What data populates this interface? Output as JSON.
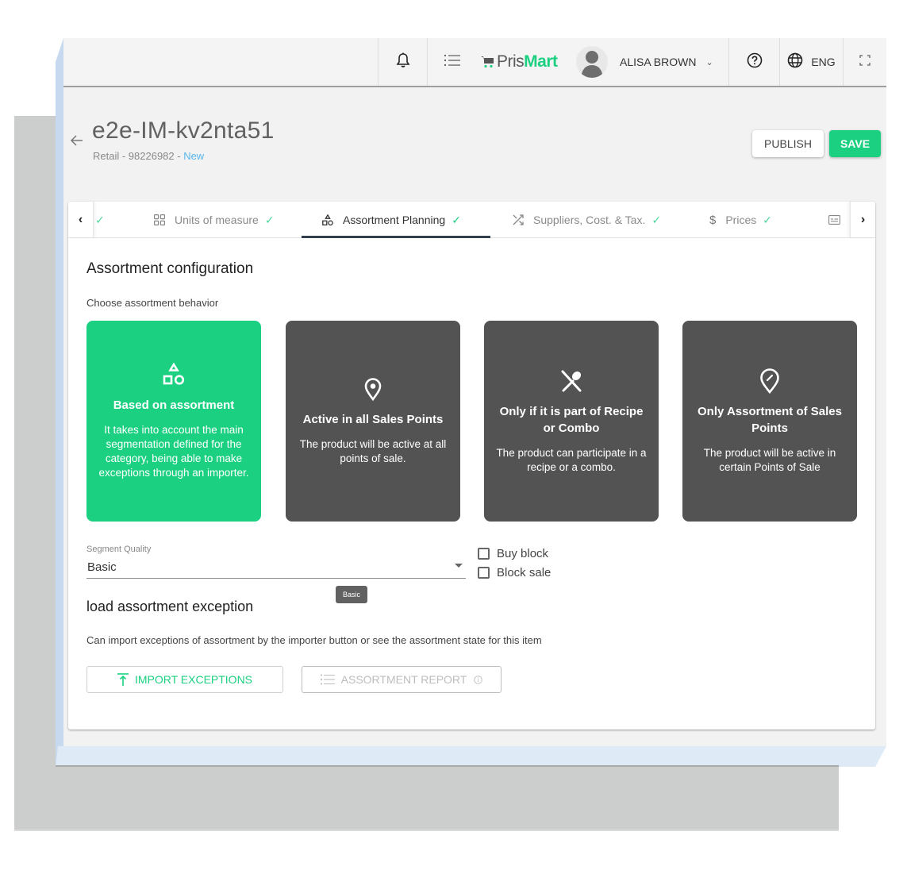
{
  "topbar": {
    "brand_prefix": "Pris",
    "brand_suffix": "Mart",
    "user_name": "ALISA BROWN",
    "language": "ENG",
    "icons": [
      "bell-icon",
      "list-menu-icon",
      "cart-icon",
      "avatar",
      "chevron-down-icon",
      "help-icon",
      "globe-icon",
      "fullscreen-icon"
    ]
  },
  "header": {
    "title": "e2e-IM-kv2nta51",
    "subtitle_prefix": "Retail - 98226982 - ",
    "status": "New",
    "publish_label": "PUBLISH",
    "save_label": "SAVE"
  },
  "tabs": [
    {
      "label": "",
      "icon": "check-icon",
      "completed": true
    },
    {
      "label": "Units of measure",
      "icon": "grid-icon",
      "completed": true
    },
    {
      "label": "Assortment Planning",
      "icon": "shapes-icon",
      "completed": true,
      "active": true
    },
    {
      "label": "Suppliers, Cost. & Tax.",
      "icon": "shuffle-icon",
      "completed": true
    },
    {
      "label": "Prices",
      "icon": "dollar-icon",
      "completed": true
    },
    {
      "label": "",
      "icon": "card-icon",
      "completed": false
    }
  ],
  "tab_check": "✓",
  "tab_prev": "‹",
  "tab_next": "›",
  "assortment": {
    "title": "Assortment configuration",
    "help": "Choose assortment behavior",
    "options": [
      {
        "title": "Based on assortment",
        "description": "It takes into account the main segmentation defined for the category, being able to make exceptions through an importer.",
        "icon": "shapes-icon",
        "selected": true
      },
      {
        "title": "Active in all Sales Points",
        "description": "The product will be active at all points of sale.",
        "icon": "location-pin-icon",
        "selected": false
      },
      {
        "title": "Only if it is part of Recipe or Combo",
        "description": "The product can participate in a recipe or a combo.",
        "icon": "utensils-icon",
        "selected": false
      },
      {
        "title": "Only Assortment of Sales Points",
        "description": "The product will be active in certain Points of Sale",
        "icon": "edit-location-icon",
        "selected": false
      }
    ]
  },
  "segment": {
    "label": "Segment Quality",
    "value": "Basic",
    "tooltip": "Basic"
  },
  "checkboxes": [
    {
      "label": "Buy block",
      "checked": false
    },
    {
      "label": "Block sale",
      "checked": false
    }
  ],
  "exceptions": {
    "title": "load assortment exception",
    "help": "Can import exceptions of assortment by the importer button or see the assortment state for this item",
    "import_label": "IMPORT EXCEPTIONS",
    "report_label": "ASSORTMENT REPORT"
  },
  "colors": {
    "accent": "#1bd081",
    "option_dark": "#535353",
    "status_new": "#58b6ea",
    "tab_underline": "#33414f"
  }
}
